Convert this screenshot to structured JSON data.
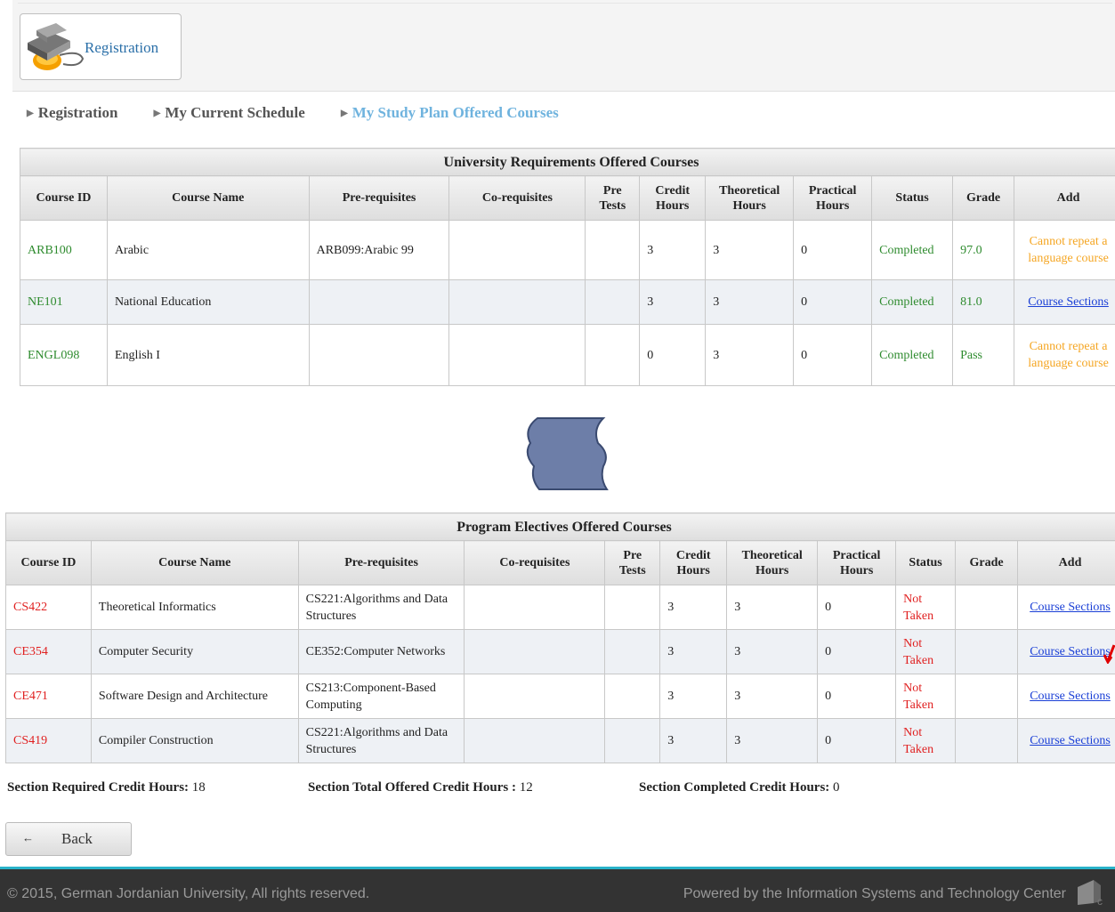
{
  "header": {
    "registration_button": "Registration"
  },
  "breadcrumb": [
    "Registration",
    "My Current Schedule",
    "My Study Plan Offered Courses"
  ],
  "columns": [
    "Course ID",
    "Course Name",
    "Pre-requisites",
    "Co-requisites",
    "Pre Tests",
    "Credit Hours",
    "Theoretical Hours",
    "Practical Hours",
    "Status",
    "Grade",
    "Add"
  ],
  "university_table": {
    "title": "University Requirements Offered Courses",
    "rows": [
      {
        "id": "ARB100",
        "name": "Arabic",
        "prereq": "ARB099:Arabic 99",
        "coreq": "",
        "pretests": "",
        "credit": "3",
        "theory": "3",
        "practical": "0",
        "status": "Completed",
        "grade": "97.0",
        "add": "Cannot repeat a language course"
      },
      {
        "id": "NE101",
        "name": "National Education",
        "prereq": "",
        "coreq": "",
        "pretests": "",
        "credit": "3",
        "theory": "3",
        "practical": "0",
        "status": "Completed",
        "grade": "81.0",
        "add": "Course Sections"
      },
      {
        "id": "ENGL098",
        "name": "English I",
        "prereq": "",
        "coreq": "",
        "pretests": "",
        "credit": "0",
        "theory": "3",
        "practical": "0",
        "status": "Completed",
        "grade": "Pass",
        "add": "Cannot repeat a language course"
      }
    ]
  },
  "electives_table": {
    "title": "Program Electives Offered Courses",
    "rows": [
      {
        "id": "CS422",
        "name": "Theoretical Informatics",
        "prereq": "CS221:Algorithms and Data Structures",
        "coreq": "",
        "pretests": "",
        "credit": "3",
        "theory": "3",
        "practical": "0",
        "status": "Not Taken",
        "grade": "",
        "add": "Course Sections"
      },
      {
        "id": "CE354",
        "name": "Computer Security",
        "prereq": "CE352:Computer Networks",
        "coreq": "",
        "pretests": "",
        "credit": "3",
        "theory": "3",
        "practical": "0",
        "status": "Not Taken",
        "grade": "",
        "add": "Course Sections"
      },
      {
        "id": "CE471",
        "name": "Software Design and Architecture",
        "prereq": "CS213:Component-Based Computing",
        "coreq": "",
        "pretests": "",
        "credit": "3",
        "theory": "3",
        "practical": "0",
        "status": "Not Taken",
        "grade": "",
        "add": "Course Sections"
      },
      {
        "id": "CS419",
        "name": "Compiler Construction",
        "prereq": "CS221:Algorithms and Data Structures",
        "coreq": "",
        "pretests": "",
        "credit": "3",
        "theory": "3",
        "practical": "0",
        "status": "Not Taken",
        "grade": "",
        "add": "Course Sections"
      }
    ]
  },
  "summary": {
    "required_label": "Section Required Credit Hours:",
    "required_value": "18",
    "offered_label": "Section Total Offered Credit Hours :",
    "offered_value": "12",
    "completed_label": "Section Completed Credit Hours:",
    "completed_value": "0"
  },
  "back_button": {
    "arrow": "←",
    "label": "Back"
  },
  "footer": {
    "copyright": "© 2015, German Jordanian University, All rights reserved.",
    "powered": "Powered by the Information Systems and Technology Center"
  },
  "colors": {
    "completed": "#2e8b2e",
    "not_taken": "#e02020",
    "warning": "#f5a623",
    "link": "#1a3fd6",
    "accent": "#29b2c9"
  }
}
